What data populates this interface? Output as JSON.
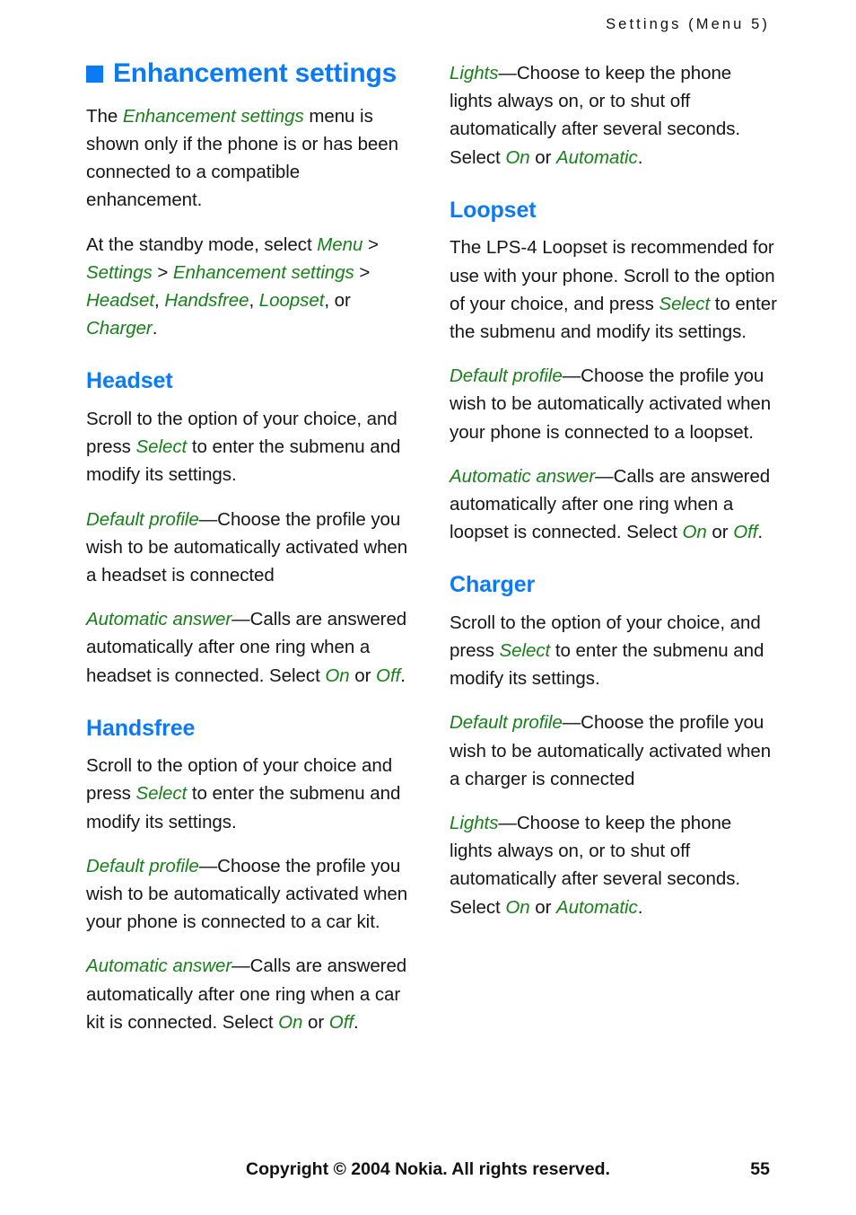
{
  "header": {
    "running_head": "Settings (Menu 5)"
  },
  "chapter": {
    "title": "Enhancement settings",
    "bullet_color": "#0b7bf5"
  },
  "colors": {
    "heading_blue": "#0b7bf5",
    "ui_term_green": "#18801a",
    "body_text": "#161616"
  },
  "left_column": {
    "intro": {
      "p1_a": "The ",
      "p1_ui1": "Enhancement settings",
      "p1_b": " menu is shown only if the phone is or has been connected to a compatible enhancement.",
      "p2_a": "At the standby mode, select ",
      "p2_ui1": "Menu",
      "p2_b": " > ",
      "p2_ui2": "Settings",
      "p2_c": " > ",
      "p2_ui3": "Enhancement settings",
      "p2_d": " > ",
      "p2_ui4": "Headset",
      "p2_e": ", ",
      "p2_ui5": "Handsfree",
      "p2_f": ", ",
      "p2_ui6": "Loopset",
      "p2_g": ", or ",
      "p2_ui7": "Charger",
      "p2_h": "."
    },
    "headset": {
      "title": "Headset",
      "intro_a": "Scroll to the option of your choice, and press ",
      "intro_ui": "Select",
      "intro_b": " to enter the submenu and modify its settings.",
      "default_profile_ui": "Default profile",
      "default_profile_text": "—Choose the profile you wish to be automatically activated when a headset is connected",
      "auto_answer_ui": "Automatic answer",
      "auto_answer_a": "—Calls are answered automatically after one ring when a headset is connected. Select ",
      "auto_answer_ui_on": "On",
      "auto_answer_b": " or ",
      "auto_answer_ui_off": "Off",
      "auto_answer_c": "."
    },
    "handsfree": {
      "title": "Handsfree",
      "intro_a": "Scroll to the option of your choice and press ",
      "intro_ui": "Select",
      "intro_b": " to enter the submenu and modify its settings.",
      "default_profile_ui": "Default profile",
      "default_profile_text": "—Choose the profile you wish to be automatically activated when your phone is connected to a car kit.",
      "auto_answer_ui": "Automatic answer",
      "auto_answer_a": "—Calls are answered automatically after one ring when a car kit is connected. Select ",
      "auto_answer_ui_on": "On",
      "auto_answer_b": " or ",
      "auto_answer_ui_off": "Off",
      "auto_answer_c": "."
    }
  },
  "right_column": {
    "lights_top": {
      "ui": "Lights",
      "a": "—Choose to keep the phone lights always on, or to shut off automatically after several seconds. Select ",
      "ui_on": "On",
      "b": " or ",
      "ui_automatic": "Automatic",
      "c": "."
    },
    "loopset": {
      "title": "Loopset",
      "intro_a": "The LPS-4 Loopset is recommended for use with your phone. Scroll to the option of your choice, and press ",
      "intro_ui": "Select",
      "intro_b": " to enter the submenu and modify its settings.",
      "default_profile_ui": "Default profile",
      "default_profile_text": "—Choose the profile you wish to be automatically activated when your phone is connected to a loopset.",
      "auto_answer_ui": "Automatic answer",
      "auto_answer_a": "—Calls are answered automatically after one ring when a loopset is connected. Select ",
      "auto_answer_ui_on": "On",
      "auto_answer_b": " or ",
      "auto_answer_ui_off": "Off",
      "auto_answer_c": "."
    },
    "charger": {
      "title": "Charger",
      "intro_a": "Scroll to the option of your choice, and press ",
      "intro_ui": "Select",
      "intro_b": " to enter the submenu and modify its settings.",
      "default_profile_ui": "Default profile",
      "default_profile_text": "—Choose the profile you wish to be automatically activated when a charger is connected",
      "lights_ui": "Lights",
      "lights_a": "—Choose to keep the phone lights always on, or to shut off automatically after several seconds. Select ",
      "lights_ui_on": "On",
      "lights_b": " or ",
      "lights_ui_automatic": "Automatic",
      "lights_c": "."
    }
  },
  "footer": {
    "copyright": "Copyright © 2004 Nokia. All rights reserved.",
    "page_number": "55"
  }
}
